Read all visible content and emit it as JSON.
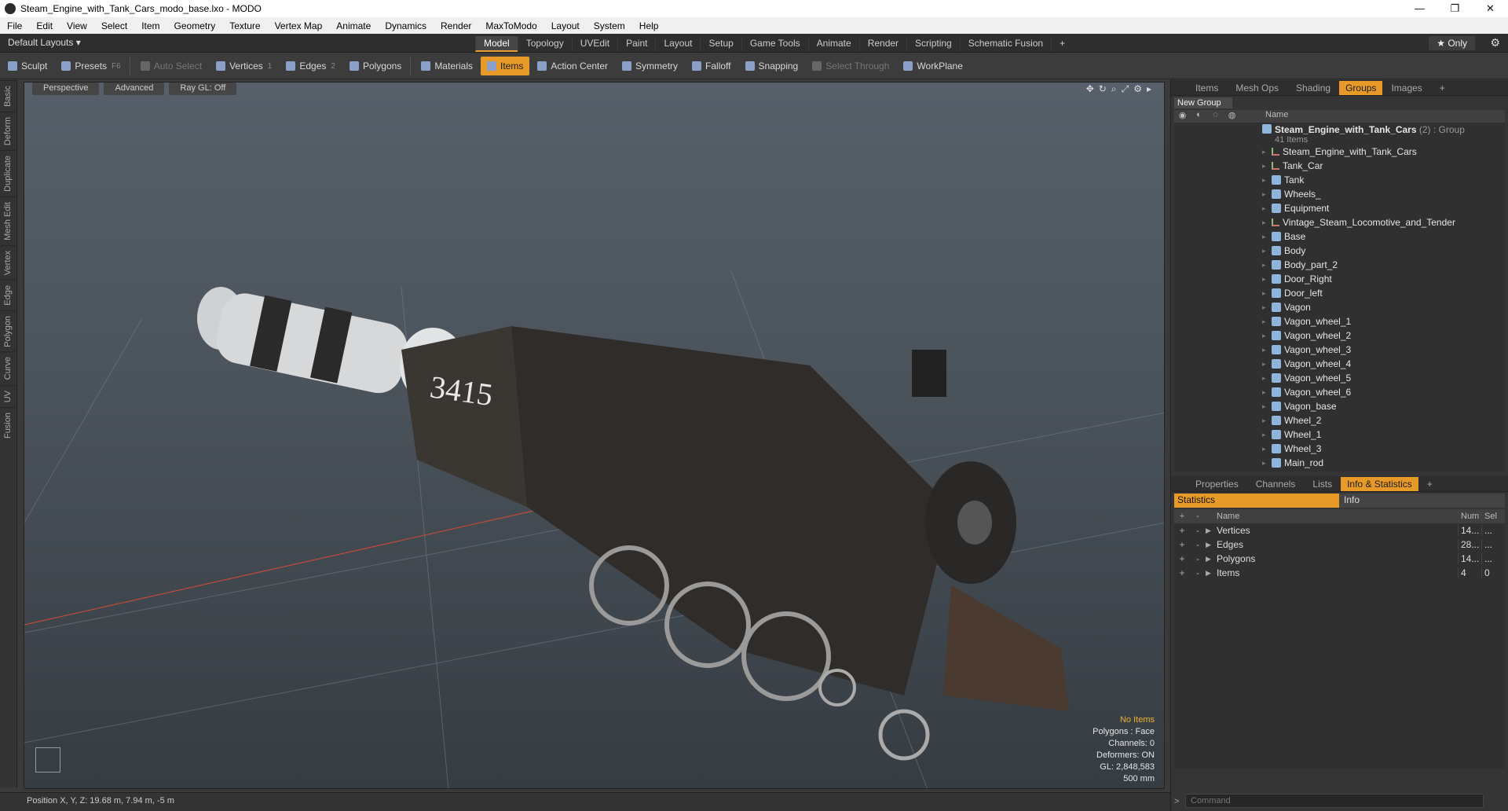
{
  "window": {
    "title": "Steam_Engine_with_Tank_Cars_modo_base.lxo - MODO",
    "controls": [
      "—",
      "❐",
      "✕"
    ]
  },
  "menu": [
    "File",
    "Edit",
    "View",
    "Select",
    "Item",
    "Geometry",
    "Texture",
    "Vertex Map",
    "Animate",
    "Dynamics",
    "Render",
    "MaxToModo",
    "Layout",
    "System",
    "Help"
  ],
  "modebar": {
    "layouts": "Default Layouts ▾",
    "tabs": [
      "Model",
      "Topology",
      "UVEdit",
      "Paint",
      "Layout",
      "Setup",
      "Game Tools",
      "Animate",
      "Render",
      "Scripting",
      "Schematic Fusion",
      "+"
    ],
    "active_tab": "Model",
    "only_label": "★ Only"
  },
  "toolbar": {
    "sculpt": "Sculpt",
    "presets": "Presets",
    "presets_key": "F6",
    "auto_select": "Auto Select",
    "vertices": "Vertices",
    "vertices_key": "1",
    "edges": "Edges",
    "edges_key": "2",
    "polygons": "Polygons",
    "materials": "Materials",
    "items": "Items",
    "action_center": "Action Center",
    "symmetry": "Symmetry",
    "falloff": "Falloff",
    "snapping": "Snapping",
    "select_through": "Select Through",
    "workplane": "WorkPlane"
  },
  "left_tabs": [
    "Basic",
    "Deform",
    "Duplicate",
    "Mesh Edit",
    "Vertex",
    "Edge",
    "Polygon",
    "Curve",
    "UV",
    "Fusion"
  ],
  "viewport": {
    "view": "Perspective",
    "shading": "Advanced",
    "raygl": "Ray GL: Off",
    "loco_number": "3415",
    "info": {
      "items": "No Items",
      "polygons": "Polygons : Face",
      "channels": "Channels: 0",
      "deformers": "Deformers: ON",
      "gl": "GL: 2,848,583",
      "scale": "500 mm"
    }
  },
  "status": {
    "position": "Position X, Y, Z:  19.68 m, 7.94 m, -5 m"
  },
  "items_panel": {
    "tabs": [
      "Items",
      "Mesh Ops",
      "Shading",
      "Groups",
      "Images",
      "+"
    ],
    "active_tab": "Groups",
    "new_group": "New Group",
    "name_header": "Name",
    "group_name": "Steam_Engine_with_Tank_Cars",
    "group_count": "(2)",
    "group_type": ": Group",
    "group_sub": "41 Items",
    "children": [
      {
        "name": "Steam_Engine_with_Tank_Cars",
        "icon": "locator-icon"
      },
      {
        "name": "Tank_Car",
        "icon": "locator-icon"
      },
      {
        "name": "Tank",
        "icon": "mesh-icon"
      },
      {
        "name": "Wheels_",
        "icon": "mesh-icon"
      },
      {
        "name": "Equipment",
        "icon": "mesh-icon"
      },
      {
        "name": "Vintage_Steam_Locomotive_and_Tender",
        "icon": "locator-icon"
      },
      {
        "name": "Base",
        "icon": "mesh-icon"
      },
      {
        "name": "Body",
        "icon": "mesh-icon"
      },
      {
        "name": "Body_part_2",
        "icon": "mesh-icon"
      },
      {
        "name": "Door_Right",
        "icon": "mesh-icon"
      },
      {
        "name": "Door_left",
        "icon": "mesh-icon"
      },
      {
        "name": "Vagon",
        "icon": "mesh-icon"
      },
      {
        "name": "Vagon_wheel_1",
        "icon": "mesh-icon"
      },
      {
        "name": "Vagon_wheel_2",
        "icon": "mesh-icon"
      },
      {
        "name": "Vagon_wheel_3",
        "icon": "mesh-icon"
      },
      {
        "name": "Vagon_wheel_4",
        "icon": "mesh-icon"
      },
      {
        "name": "Vagon_wheel_5",
        "icon": "mesh-icon"
      },
      {
        "name": "Vagon_wheel_6",
        "icon": "mesh-icon"
      },
      {
        "name": "Vagon_base",
        "icon": "mesh-icon"
      },
      {
        "name": "Wheel_2",
        "icon": "mesh-icon"
      },
      {
        "name": "Wheel_1",
        "icon": "mesh-icon"
      },
      {
        "name": "Wheel_3",
        "icon": "mesh-icon"
      },
      {
        "name": "Main_rod",
        "icon": "mesh-icon"
      }
    ]
  },
  "stats_panel": {
    "tabs": [
      "Properties",
      "Channels",
      "Lists",
      "Info & Statistics",
      "+"
    ],
    "active_tab": "Info & Statistics",
    "statistics_label": "Statistics",
    "info_label": "Info",
    "headers": {
      "name": "Name",
      "num": "Num",
      "sel": "Sel"
    },
    "rows": [
      {
        "name": "Vertices",
        "num": "14...",
        "sel": "..."
      },
      {
        "name": "Edges",
        "num": "28...",
        "sel": "..."
      },
      {
        "name": "Polygons",
        "num": "14...",
        "sel": "..."
      },
      {
        "name": "Items",
        "num": "4",
        "sel": "0"
      }
    ]
  },
  "command": {
    "placeholder": "Command"
  },
  "colors": {
    "accent": "#e89a28",
    "viewport_top": "#57606a",
    "viewport_bottom": "#353c42"
  }
}
